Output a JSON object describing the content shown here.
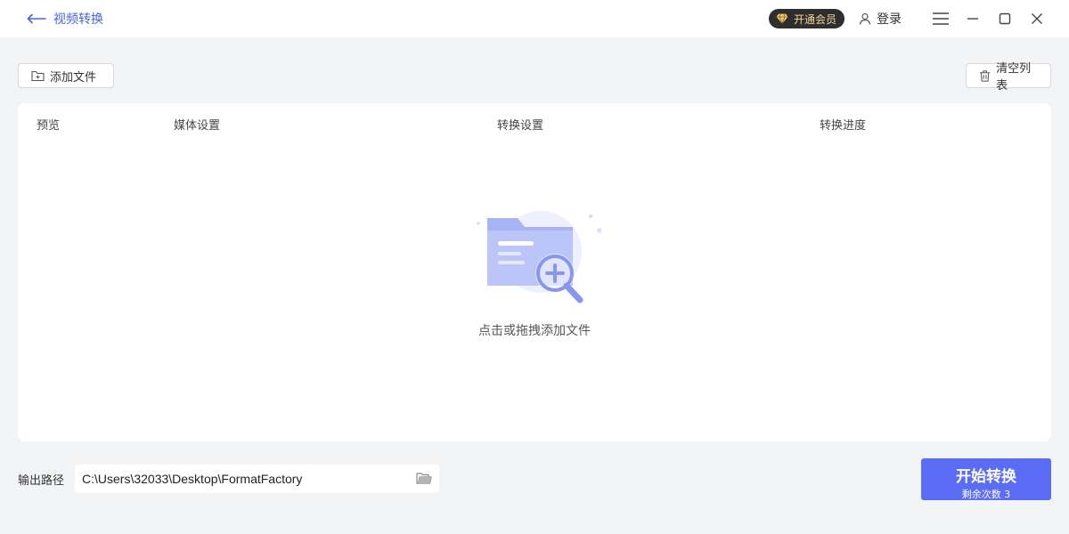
{
  "titlebar": {
    "back_label": "视频转换",
    "vip_label": "开通会员",
    "login_label": "登录"
  },
  "toolbar": {
    "add_file_label": "添加文件",
    "clear_list_label": "清空列表"
  },
  "table": {
    "columns": [
      "预览",
      "媒体设置",
      "转换设置",
      "转换进度"
    ]
  },
  "empty_state": {
    "hint": "点击或拖拽添加文件"
  },
  "output": {
    "label": "输出路径",
    "path": "C:\\Users\\32033\\Desktop\\FormatFactory"
  },
  "start_button": {
    "label": "开始转换",
    "remaining": "剩余次数 3"
  },
  "colors": {
    "accent": "#5b6cf7",
    "link": "#4a63d8",
    "vip_bg": "#2e2e2e",
    "vip_text": "#f3d59a"
  }
}
